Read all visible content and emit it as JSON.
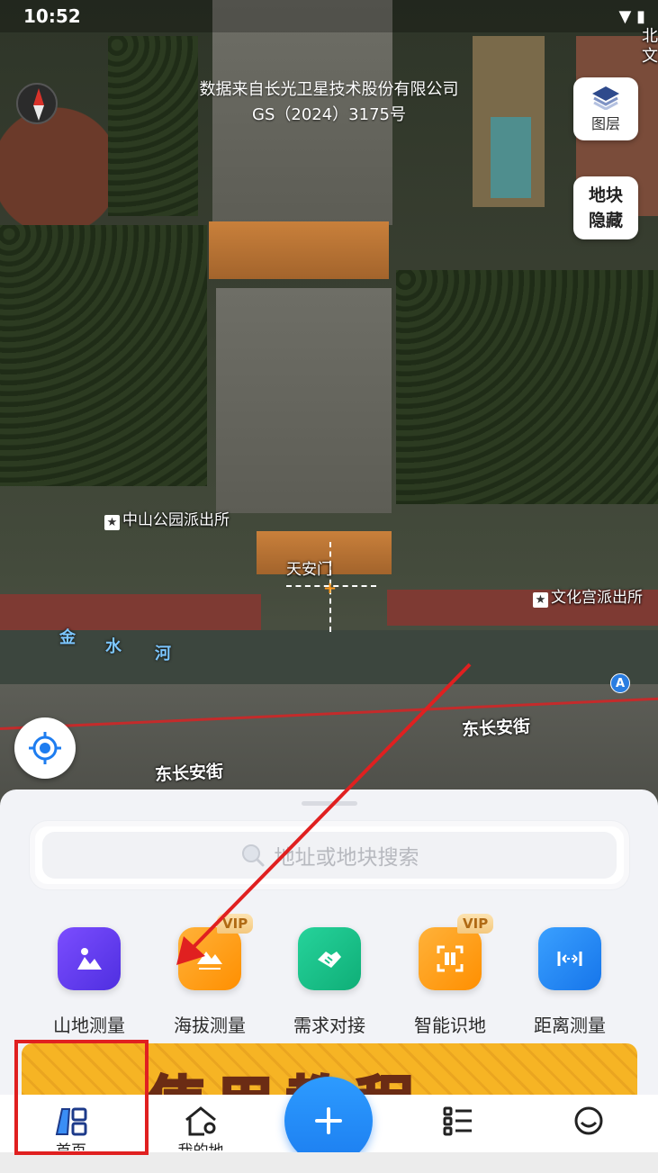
{
  "status_bar": {
    "time": "10:52",
    "signal": "▼ ▮"
  },
  "map": {
    "attribution_line1": "数据来自长光卫星技术股份有限公司",
    "attribution_line2": "GS（2024）3175号",
    "layers_button_label": "图层",
    "hide_button_line1": "地块",
    "hide_button_line2": "隐藏",
    "poi_zhongshan": "中山公园派出所",
    "poi_wenhuagong": "文化宫派出所",
    "poi_tiananmen": "天安门",
    "poi_top_right_1": "北",
    "poi_top_right_2": "文",
    "road_label_right": "东长安街",
    "road_label_left": "东长安街",
    "river_chars": [
      "金",
      "水",
      "河"
    ],
    "poi_a_badge": "A"
  },
  "sheet": {
    "search_placeholder": "地址或地块搜索",
    "tools": [
      {
        "label": "山地测量",
        "color": "#6a3cf5",
        "icon": "mountain-person-icon",
        "vip": ""
      },
      {
        "label": "海拔测量",
        "color": "#ff9f0a",
        "icon": "altitude-icon",
        "vip": "VIP"
      },
      {
        "label": "需求对接",
        "color": "#16c08a",
        "icon": "handshake-icon",
        "vip": ""
      },
      {
        "label": "智能识地",
        "color": "#ff9f0a",
        "icon": "scan-land-icon",
        "vip": "VIP"
      },
      {
        "label": "距离测量",
        "color": "#1e8bf5",
        "icon": "ruler-icon",
        "vip": ""
      }
    ],
    "banner_text": "使用教程"
  },
  "nav": {
    "home_label": "首页",
    "my_plots_label": "我的地",
    "list_label": "",
    "profile_label": ""
  },
  "colors": {
    "accent": "#1c7ef0",
    "annotation_red": "#e02020"
  }
}
